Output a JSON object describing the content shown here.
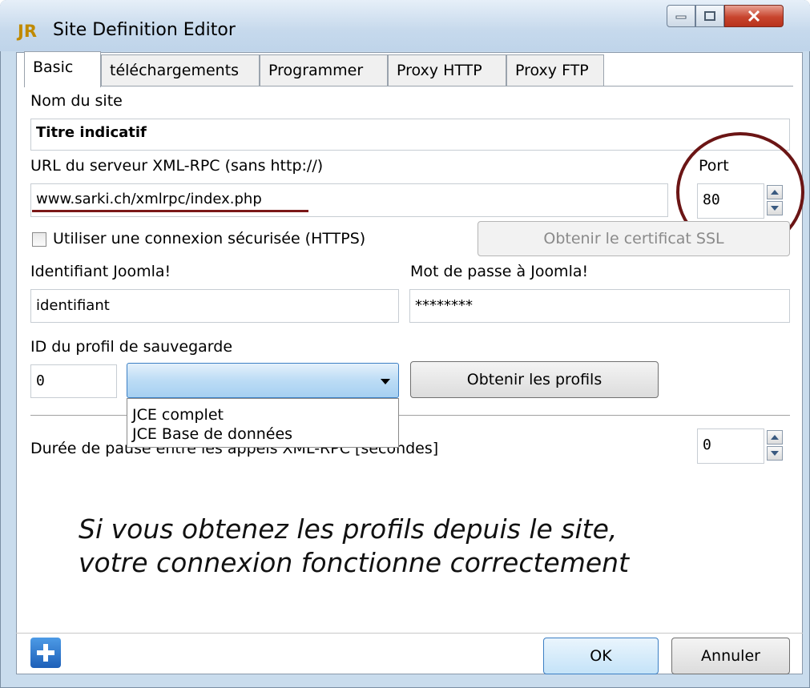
{
  "window": {
    "title": "Site Definition Editor",
    "logo": "JR"
  },
  "tabs": [
    "Basic",
    "téléchargements",
    "Programmer",
    "Proxy HTTP",
    "Proxy FTP"
  ],
  "form": {
    "site_name_label": "Nom du site",
    "site_name_value": "Titre indicatif",
    "url_label": "URL du serveur XML-RPC (sans http://)",
    "url_value": "www.sarki.ch/xmlrpc/index.php",
    "port_label": "Port",
    "port_value": "80",
    "https_label": "Utiliser une connexion sécurisée (HTTPS)",
    "ssl_button": "Obtenir le certificat SSL",
    "username_label": "Identifiant Joomla!",
    "username_value": "identifiant",
    "password_label": "Mot de passe à Joomla!",
    "password_value": "********",
    "profile_label": "ID du profil de sauvegarde",
    "profile_id_value": "0",
    "profile_options": [
      "JCE complet",
      "JCE Base de données"
    ],
    "get_profiles_button": "Obtenir les profils",
    "pause_label": "Durée de pause entre les appels XML-RPC [secondes]",
    "pause_value": "0"
  },
  "annotation": {
    "line1": "Si vous obtenez les profils depuis le site,",
    "line2": "votre connexion fonctionne correctement"
  },
  "footer": {
    "ok": "OK",
    "cancel": "Annuler"
  },
  "colors": {
    "highlight": "#7b1818",
    "dropdown_accent": "#3c8ad6",
    "close_red": "#c8452e"
  }
}
